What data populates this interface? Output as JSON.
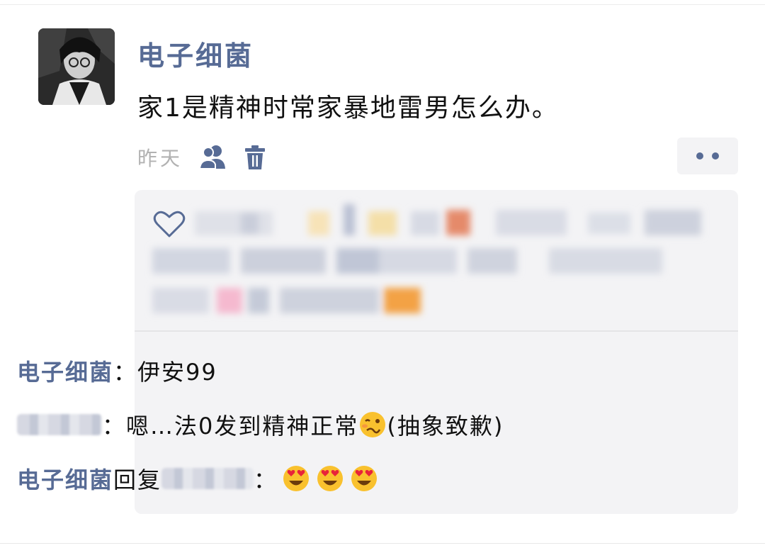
{
  "post": {
    "author": "电子细菌",
    "text": "家1是精神时常家暴地雷男怎么办。",
    "time": "昨天"
  },
  "icons": {
    "friends": "friends-visibility-icon",
    "trash": "trash-icon",
    "more": "more-icon",
    "heart": "heart-icon"
  },
  "colors": {
    "link": "#576b95",
    "time": "#b2b2b2",
    "panel": "#f3f3f5"
  },
  "comments": [
    {
      "author": "电子细菌",
      "sep": "：",
      "text": "伊安99"
    },
    {
      "author_hidden": true,
      "sep": "：",
      "text": "嗯…法0发到精神正常",
      "emoji": "woozy-face",
      "suffix": "(抽象致歉)"
    },
    {
      "author": "电子细菌",
      "reply_word": "回复",
      "sep": "：",
      "emojis": [
        "heart-eyes-face",
        "heart-eyes-face",
        "heart-eyes-face"
      ]
    }
  ]
}
